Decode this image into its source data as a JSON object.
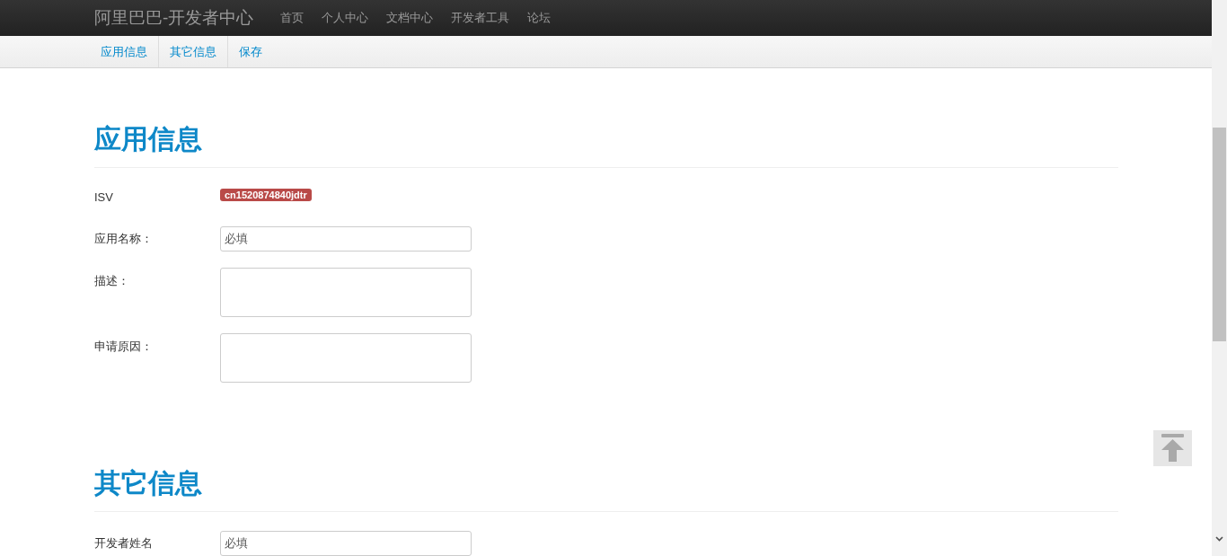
{
  "navbar": {
    "brand": "阿里巴巴-开发者中心",
    "links": [
      "首页",
      "个人中心",
      "文档中心",
      "开发者工具",
      "论坛"
    ]
  },
  "subnav": {
    "items": [
      "应用信息",
      "其它信息",
      "保存"
    ]
  },
  "sections": [
    {
      "title": "应用信息",
      "rows": [
        {
          "kind": "badge",
          "label": "ISV",
          "value": "cn1520874840jdtr"
        },
        {
          "kind": "text",
          "label": "应用名称：",
          "value": "必填"
        },
        {
          "kind": "textarea",
          "label": "描述：",
          "value": ""
        },
        {
          "kind": "textarea",
          "label": "申请原因：",
          "value": ""
        }
      ]
    },
    {
      "title": "其它信息",
      "rows": [
        {
          "kind": "text",
          "label": "开发者姓名",
          "value": "必填"
        }
      ]
    }
  ]
}
